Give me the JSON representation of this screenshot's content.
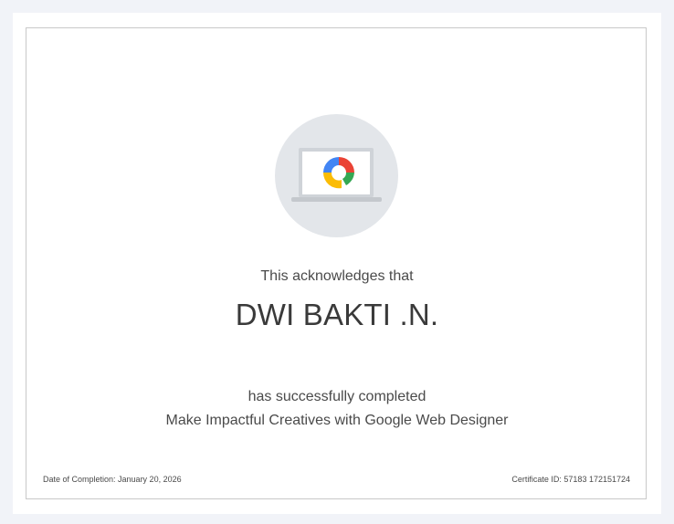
{
  "certificate": {
    "intro": "This acknowledges that",
    "recipient": "DWI BAKTI .N.",
    "completed_text": "has successfully completed",
    "course": "Make Impactful Creatives with Google Web Designer",
    "completion_date": "Date of Completion: January 20, 2026",
    "certificate_id": "Certificate ID: 57183 172151724"
  },
  "colors": {
    "background": "#f1f3f8",
    "badge_circle": "#e3e6ea",
    "logo_blue": "#4285f4",
    "logo_red": "#ea4335",
    "logo_yellow": "#fbbc05",
    "logo_green": "#34a853"
  },
  "icons": {
    "badge": "laptop-with-web-designer-logo-icon"
  }
}
